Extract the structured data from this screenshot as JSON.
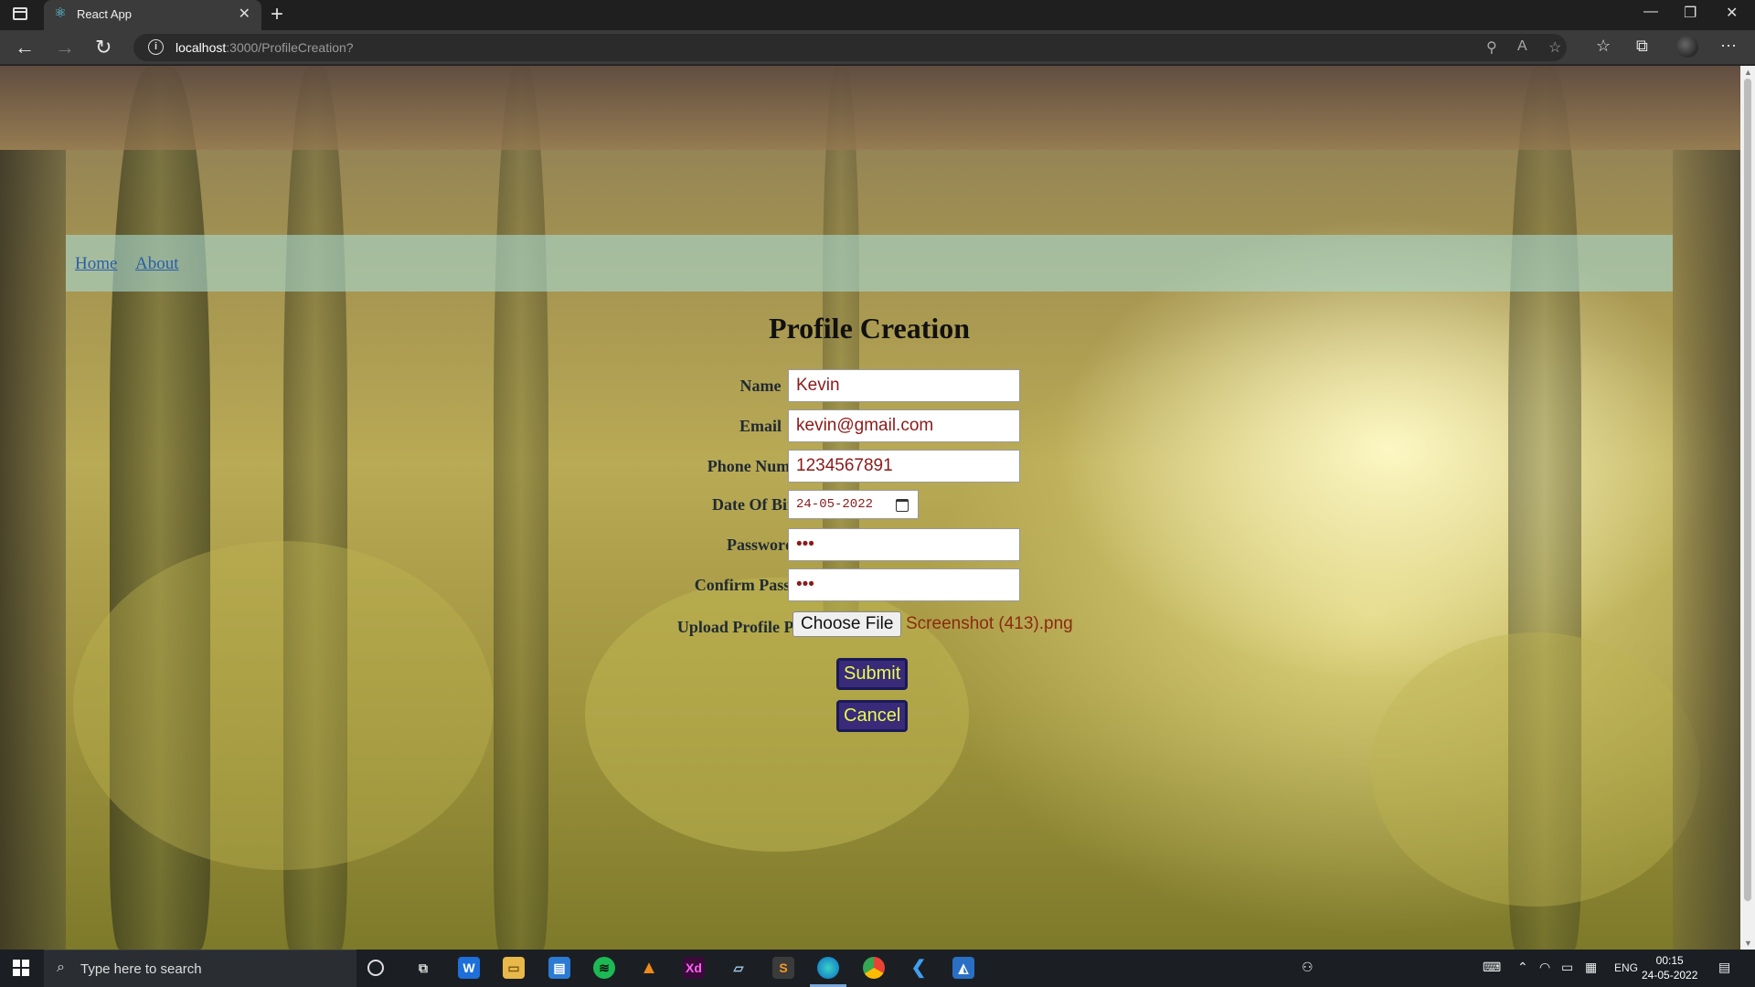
{
  "browser": {
    "tab_title": "React App",
    "url_host": "localhost",
    "url_rest": ":3000/ProfileCreation?"
  },
  "nav": {
    "links": [
      "Home",
      "About"
    ]
  },
  "form": {
    "heading": "Profile Creation",
    "fields": [
      {
        "label": "Name",
        "value": "Kevin"
      },
      {
        "label": "Email",
        "value": "kevin@gmail.com"
      },
      {
        "label": "Phone Number",
        "value": "1234567891"
      },
      {
        "label": "Date Of Birth",
        "value": "24-05-2022"
      },
      {
        "label": "Password",
        "value": "•••"
      },
      {
        "label": "Confirm Password",
        "value": "•••"
      }
    ],
    "upload": {
      "label": "Upload Profile Picture",
      "button": "Choose File",
      "file_name": "Screenshot (413).png"
    },
    "submit_label": "Submit",
    "cancel_label": "Cancel"
  },
  "taskbar": {
    "search_placeholder": "Type here to search",
    "language": "ENG",
    "time": "00:15",
    "date": "24-05-2022"
  },
  "colors": {
    "button_bg": "#3a2a7a",
    "button_text": "#e6ff4a",
    "input_text": "#8b1a1a",
    "nav_link": "#2a5ea8"
  }
}
